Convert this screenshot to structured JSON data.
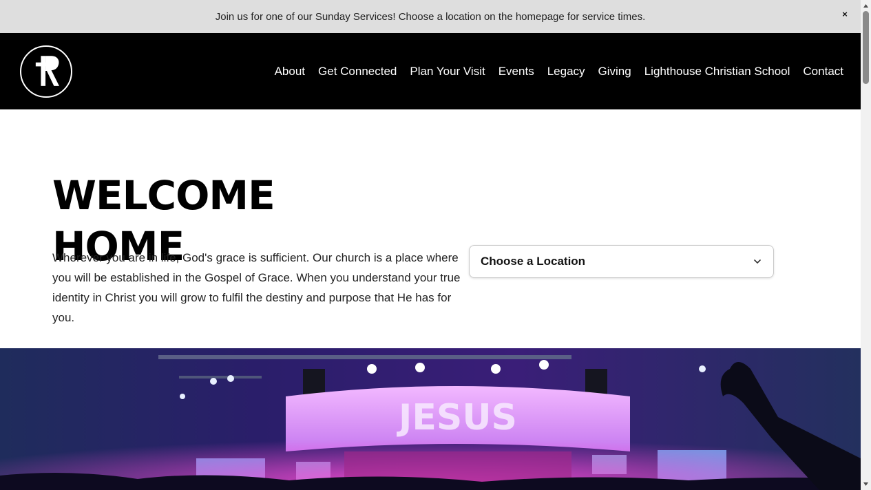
{
  "announcement": {
    "text": "Join us for one of our Sunday Services! Choose a location on the homepage for service times.",
    "close_icon": "×"
  },
  "header": {
    "logo_icon": "church-logo-icon",
    "nav": [
      {
        "label": "About"
      },
      {
        "label": "Get Connected"
      },
      {
        "label": "Plan Your Visit"
      },
      {
        "label": "Events"
      },
      {
        "label": "Legacy"
      },
      {
        "label": "Giving"
      },
      {
        "label": "Lighthouse Christian School"
      },
      {
        "label": "Contact"
      }
    ]
  },
  "hero": {
    "title_line1": "WELCOME",
    "title_line2": "HOME",
    "body": "Wherever you are in life, God's grace is sufficient. Our church is a place where you will be established in the Gospel of Grace. When you understand your true identity in Christ you will grow to fulfil the destiny and purpose that He has for you.",
    "location_select": {
      "selected": "Choose a Location",
      "icon": "chevron-down-icon"
    },
    "image_screen_text": "JESUS"
  },
  "colors": {
    "announcement_bg": "#dedede",
    "header_bg": "#000000",
    "page_bg": "#ffffff",
    "text": "#111111"
  }
}
